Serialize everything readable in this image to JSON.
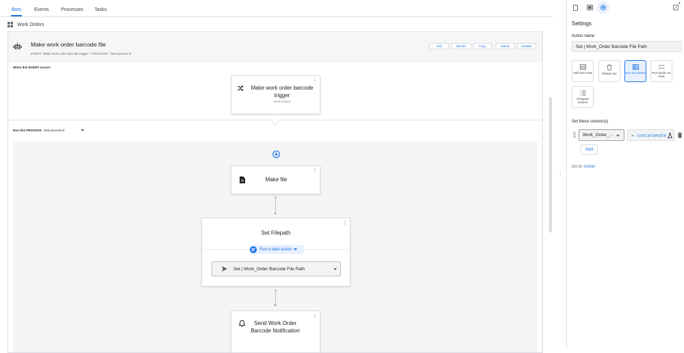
{
  "colors": {
    "accent": "#1a73e8",
    "border": "#dadce0",
    "text": "#202124",
    "muted": "#5f6368"
  },
  "nav": {
    "tabs": [
      "Bots",
      "Events",
      "Processes",
      "Tasks"
    ],
    "active": "Bots"
  },
  "breadcrumb": {
    "icon": "grid-icon",
    "label": "Work Orders"
  },
  "bot": {
    "title": "Make work order barcode file",
    "subtitle": "EVENT: \"Make work order barcode trigger\" > PROCESS: \"New process 8\"",
    "buttons": {
      "test": "Test",
      "monitor": "Monitor",
      "copy": "Copy",
      "delete": "Delete",
      "disable": "Disable"
    }
  },
  "event_section": {
    "label": "When this EVENT occurs:",
    "card": {
      "title": "Make work order barcode trigger",
      "subtitle": "Work Orders",
      "icon": "shuffle-icon"
    }
  },
  "process_section": {
    "label_prefix": "Run this PROCESS:",
    "label_value": "New process 8",
    "steps": [
      {
        "title": "Make file",
        "icon": "file-icon"
      },
      {
        "title": "Set Filepath",
        "run_label": "Run a data action",
        "action_value": "Set | Work_Order Barcode File Path",
        "icon": "send-icon"
      },
      {
        "title": "Send Work Order Barcode Notification",
        "icon": "bell-icon"
      }
    ]
  },
  "settings": {
    "title": "Settings",
    "action_name_label": "Action name",
    "action_name_value": "Set | Work_Order Barcode File Path",
    "actions": [
      {
        "label": "Add new rows",
        "icon": "add-rows-icon"
      },
      {
        "label": "Delete row",
        "icon": "trash-icon"
      },
      {
        "label": "Set row values",
        "icon": "set-values-icon",
        "selected": true
      },
      {
        "label": "Run action on rows",
        "icon": "checklist-icon"
      },
      {
        "label": "Grouped actions",
        "icon": "list-icon"
      }
    ],
    "set_columns_label": "Set these column(s)",
    "column": {
      "name": "Work_Order_...",
      "expr_prefix": "=",
      "expr": "concatenate"
    },
    "add_button": "Add",
    "goto_label": "Go to:",
    "goto_link": "Action"
  }
}
